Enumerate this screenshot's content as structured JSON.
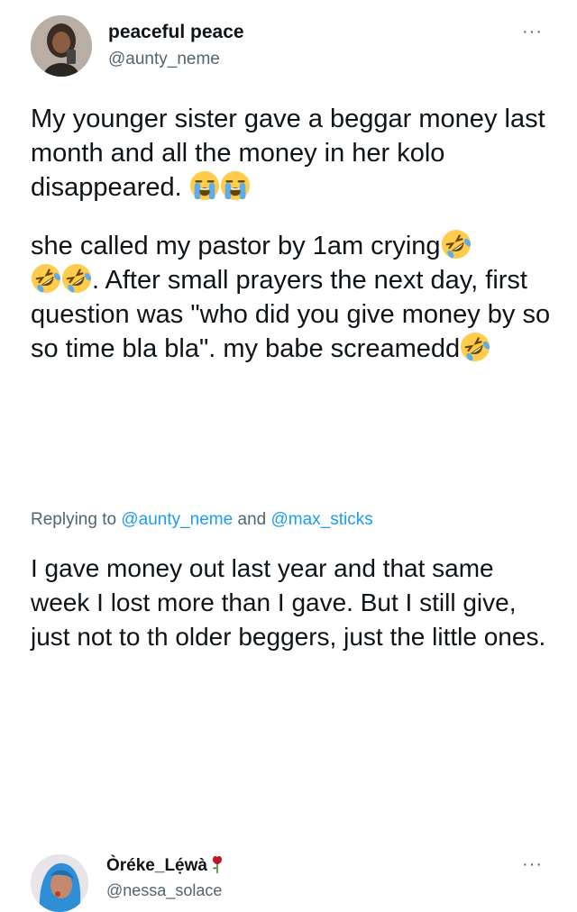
{
  "tweet": {
    "author": {
      "display_name": "peaceful peace",
      "handle": "@aunty_neme",
      "avatar_icon": "profile-photo"
    },
    "more_icon": "···",
    "paragraph1": {
      "text": "My younger sister gave a beggar money last month and all the money in her kolo disappeared.",
      "emojis": [
        "loudly-crying-face",
        "loudly-crying-face"
      ]
    },
    "paragraph2": {
      "part1": "she called my pastor by 1am crying",
      "part2": ". After small prayers the next day, first question was \"who did you give money by so so time bla bla\". my babe screamedd",
      "emojis": [
        "rolling-on-floor-laughing-face",
        "rolling-on-floor-laughing-face",
        "rolling-on-floor-laughing-face",
        "rolling-on-floor-laughing-face"
      ]
    }
  },
  "reply": {
    "author": {
      "display_name": "Òréke_Lẹ́wà",
      "handle": "@nessa_solace",
      "name_emoji": "rose",
      "avatar_icon": "profile-photo"
    },
    "more_icon": "···",
    "replying_prefix": "Replying to",
    "mention1": "@aunty_neme",
    "joiner": "and",
    "mention2": "@max_sticks",
    "text": "I gave money out last year and that same week I lost more than I gave. But I still give, just not to th older beggers, just the little ones."
  },
  "colors": {
    "text": "#0f1419",
    "secondary": "#536471",
    "link": "#1d9bf0",
    "background": "#ffffff"
  }
}
